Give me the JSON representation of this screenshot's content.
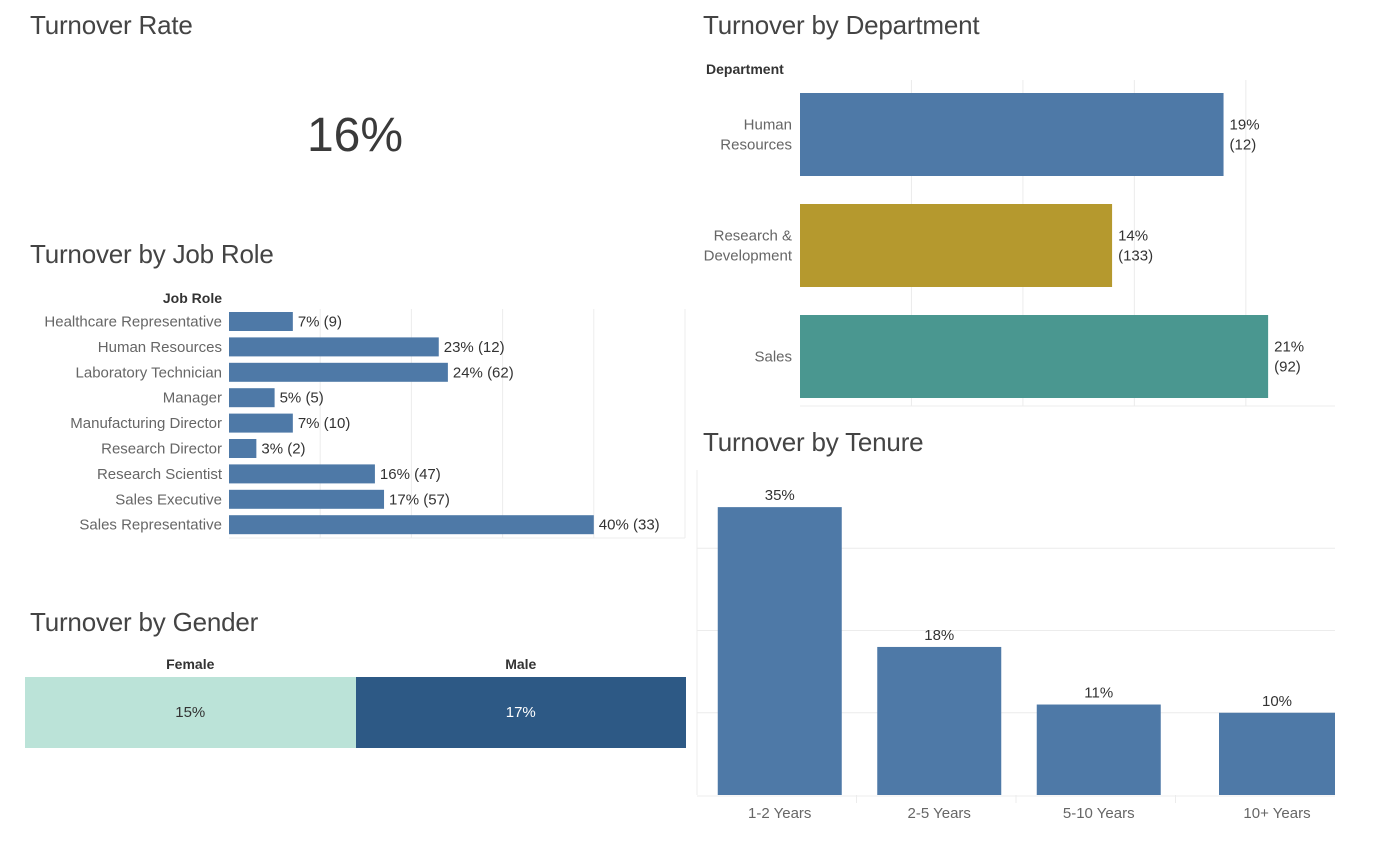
{
  "kpi": {
    "title": "Turnover Rate",
    "value": "16%"
  },
  "chart_data": [
    {
      "id": "job_role",
      "type": "bar",
      "orientation": "horizontal",
      "title": "Turnover by Job Role",
      "axis_header": "Job Role",
      "xlim": [
        0,
        50
      ],
      "grid_step": 10,
      "color": "#4e79a7",
      "categories": [
        "Healthcare Representative",
        "Human Resources",
        "Laboratory Technician",
        "Manager",
        "Manufacturing Director",
        "Research Director",
        "Research Scientist",
        "Sales Executive",
        "Sales Representative"
      ],
      "values": [
        7,
        23,
        24,
        5,
        7,
        3,
        16,
        17,
        40
      ],
      "counts": [
        9,
        12,
        62,
        5,
        10,
        2,
        47,
        57,
        33
      ],
      "labels": [
        "7% (9)",
        "23% (12)",
        "24% (62)",
        "5% (5)",
        "7% (10)",
        "3% (2)",
        "16% (47)",
        "17% (57)",
        "40% (33)"
      ]
    },
    {
      "id": "department",
      "type": "bar",
      "orientation": "horizontal",
      "title": "Turnover by Department",
      "axis_header": "Department",
      "xlim": [
        0,
        24
      ],
      "grid_step": 5,
      "categories": [
        [
          "Human",
          "Resources"
        ],
        [
          "Research &",
          "Development"
        ],
        [
          "Sales"
        ]
      ],
      "values": [
        19,
        14,
        21
      ],
      "counts": [
        12,
        133,
        92
      ],
      "labels": [
        [
          "19%",
          "(12)"
        ],
        [
          "14%",
          "(133)"
        ],
        [
          "21%",
          "(92)"
        ]
      ],
      "colors": [
        "#4e79a7",
        "#b5992e",
        "#4a9790"
      ]
    },
    {
      "id": "gender",
      "type": "table",
      "title": "Turnover by Gender",
      "categories": [
        "Female",
        "Male"
      ],
      "values": [
        15,
        17
      ],
      "labels": [
        "15%",
        "17%"
      ],
      "colors": [
        "#bbe3d8",
        "#2d5985"
      ],
      "text_colors": [
        "#333333",
        "#ffffff"
      ]
    },
    {
      "id": "tenure",
      "type": "bar",
      "orientation": "vertical",
      "title": "Turnover by Tenure",
      "ylim": [
        0,
        40
      ],
      "grid_step": 10,
      "color": "#4e79a7",
      "categories": [
        "1-2 Years",
        "2-5 Years",
        "5-10 Years",
        "10+ Years"
      ],
      "values": [
        35,
        18,
        11,
        10
      ],
      "labels": [
        "35%",
        "18%",
        "11%",
        "10%"
      ]
    }
  ]
}
